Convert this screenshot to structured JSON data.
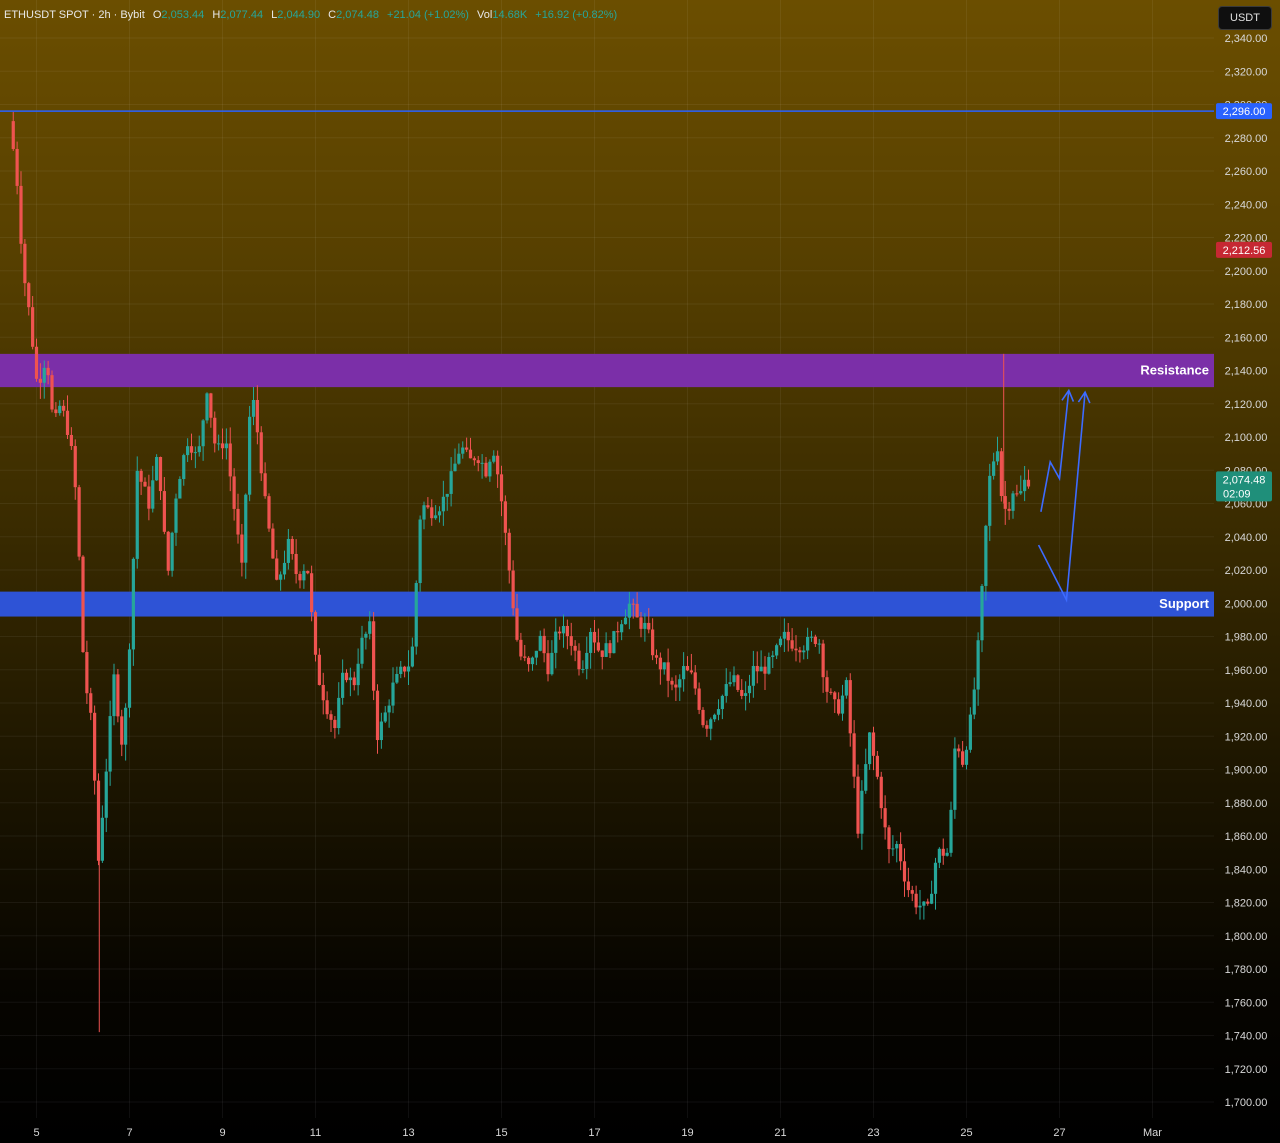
{
  "header": {
    "symbol": "ETHUSDT SPOT · 2h · Bybit",
    "open_label": "O",
    "open": "2,053.44",
    "high_label": "H",
    "high": "2,077.44",
    "low_label": "L",
    "low": "2,044.90",
    "close_label": "C",
    "close": "2,074.48",
    "change": "+21.04 (+1.02%)",
    "vol_label": "Vol",
    "vol": "14.68K",
    "vol_change": "+16.92 (+0.82%)"
  },
  "currency_button": "USDT",
  "chart_data": {
    "type": "candlestick",
    "price_axis": {
      "min": 1700,
      "max": 2340,
      "ticks": [
        "2,340.00",
        "2,320.00",
        "2,300.00",
        "2,280.00",
        "2,260.00",
        "2,240.00",
        "2,220.00",
        "2,200.00",
        "2,180.00",
        "2,160.00",
        "2,140.00",
        "2,120.00",
        "2,100.00",
        "2,080.00",
        "2,060.00",
        "2,040.00",
        "2,020.00",
        "2,000.00",
        "1,980.00",
        "1,960.00",
        "1,940.00",
        "1,920.00",
        "1,900.00",
        "1,880.00",
        "1,860.00",
        "1,840.00",
        "1,820.00",
        "1,800.00",
        "1,780.00",
        "1,760.00",
        "1,740.00",
        "1,720.00",
        "1,700.00"
      ]
    },
    "time_axis": {
      "labels": [
        {
          "text": "5",
          "day": 5
        },
        {
          "text": "7",
          "day": 7
        },
        {
          "text": "9",
          "day": 9
        },
        {
          "text": "11",
          "day": 11
        },
        {
          "text": "13",
          "day": 13
        },
        {
          "text": "15",
          "day": 15
        },
        {
          "text": "17",
          "day": 17
        },
        {
          "text": "19",
          "day": 19
        },
        {
          "text": "21",
          "day": 21
        },
        {
          "text": "23",
          "day": 23
        },
        {
          "text": "25",
          "day": 25
        },
        {
          "text": "27",
          "day": 27
        },
        {
          "text": "Mar",
          "day": 29
        }
      ]
    },
    "grid": true,
    "horizontal_line": {
      "price": 2296,
      "label": "2,296.00",
      "color": "#2962ff"
    },
    "price_labels": [
      {
        "price": 2212.56,
        "label": "2,212.56",
        "color": "#c62833"
      },
      {
        "price": 2074.48,
        "label": "2,074.48",
        "sublabel": "02:09",
        "color": "#1f8f7a"
      }
    ],
    "zones": [
      {
        "label": "Resistance",
        "low": 2130,
        "high": 2150,
        "color": "#7b2fa8"
      },
      {
        "label": "Support",
        "low": 1992,
        "high": 2007,
        "color": "#2e53d6"
      }
    ],
    "candle_colors": {
      "up": "#26a69a",
      "down": "#ef5350"
    },
    "anchors": [
      [
        4.5,
        2290
      ],
      [
        4.65,
        2260
      ],
      [
        4.8,
        2200
      ],
      [
        4.95,
        2170
      ],
      [
        5.1,
        2130
      ],
      [
        5.3,
        2150
      ],
      [
        5.45,
        2105
      ],
      [
        5.6,
        2120
      ],
      [
        5.8,
        2100
      ],
      [
        5.95,
        2060
      ],
      [
        6.1,
        1960
      ],
      [
        6.3,
        1920
      ],
      [
        6.4,
        1840
      ],
      [
        6.55,
        1890
      ],
      [
        6.75,
        1955
      ],
      [
        6.95,
        1910
      ],
      [
        7.1,
        1985
      ],
      [
        7.25,
        2080
      ],
      [
        7.5,
        2060
      ],
      [
        7.7,
        2090
      ],
      [
        7.9,
        2015
      ],
      [
        8.1,
        2070
      ],
      [
        8.35,
        2100
      ],
      [
        8.55,
        2085
      ],
      [
        8.75,
        2130
      ],
      [
        8.95,
        2090
      ],
      [
        9.15,
        2100
      ],
      [
        9.3,
        2065
      ],
      [
        9.5,
        2020
      ],
      [
        9.7,
        2130
      ],
      [
        9.85,
        2100
      ],
      [
        10.0,
        2060
      ],
      [
        10.25,
        2010
      ],
      [
        10.5,
        2035
      ],
      [
        10.7,
        2015
      ],
      [
        10.9,
        2025
      ],
      [
        11.1,
        1960
      ],
      [
        11.3,
        1940
      ],
      [
        11.5,
        1925
      ],
      [
        11.7,
        1960
      ],
      [
        11.9,
        1950
      ],
      [
        12.05,
        1975
      ],
      [
        12.25,
        1985
      ],
      [
        12.4,
        1920
      ],
      [
        12.55,
        1930
      ],
      [
        12.75,
        1950
      ],
      [
        12.95,
        1960
      ],
      [
        13.15,
        1965
      ],
      [
        13.35,
        2060
      ],
      [
        13.55,
        2055
      ],
      [
        13.8,
        2060
      ],
      [
        14.0,
        2075
      ],
      [
        14.2,
        2095
      ],
      [
        14.4,
        2085
      ],
      [
        14.55,
        2090
      ],
      [
        14.75,
        2080
      ],
      [
        14.9,
        2095
      ],
      [
        15.05,
        2070
      ],
      [
        15.25,
        2020
      ],
      [
        15.45,
        1970
      ],
      [
        15.7,
        1960
      ],
      [
        15.9,
        1980
      ],
      [
        16.1,
        1960
      ],
      [
        16.3,
        1985
      ],
      [
        16.55,
        1980
      ],
      [
        16.8,
        1960
      ],
      [
        17.0,
        1985
      ],
      [
        17.2,
        1970
      ],
      [
        17.45,
        1975
      ],
      [
        17.65,
        1990
      ],
      [
        17.85,
        2000
      ],
      [
        18.0,
        1990
      ],
      [
        18.2,
        1985
      ],
      [
        18.4,
        1965
      ],
      [
        18.6,
        1960
      ],
      [
        18.8,
        1945
      ],
      [
        19.0,
        1960
      ],
      [
        19.2,
        1955
      ],
      [
        19.45,
        1925
      ],
      [
        19.65,
        1935
      ],
      [
        19.85,
        1945
      ],
      [
        20.05,
        1955
      ],
      [
        20.3,
        1940
      ],
      [
        20.5,
        1960
      ],
      [
        20.7,
        1960
      ],
      [
        20.9,
        1965
      ],
      [
        21.15,
        1980
      ],
      [
        21.4,
        1975
      ],
      [
        21.6,
        1975
      ],
      [
        21.9,
        1980
      ],
      [
        22.05,
        1950
      ],
      [
        22.3,
        1935
      ],
      [
        22.5,
        1950
      ],
      [
        22.75,
        1865
      ],
      [
        23.0,
        1920
      ],
      [
        23.2,
        1890
      ],
      [
        23.4,
        1850
      ],
      [
        23.6,
        1855
      ],
      [
        23.8,
        1830
      ],
      [
        24.0,
        1820
      ],
      [
        24.25,
        1815
      ],
      [
        24.45,
        1850
      ],
      [
        24.7,
        1850
      ],
      [
        24.85,
        1920
      ],
      [
        25.0,
        1905
      ],
      [
        25.15,
        1925
      ],
      [
        25.3,
        1960
      ],
      [
        25.45,
        2020
      ],
      [
        25.55,
        2070
      ],
      [
        25.65,
        2085
      ],
      [
        25.75,
        2095
      ],
      [
        25.85,
        2060
      ],
      [
        25.95,
        2055
      ],
      [
        26.1,
        2070
      ],
      [
        26.2,
        2062
      ],
      [
        26.35,
        2074.48
      ]
    ],
    "special_wicks": [
      {
        "day": 6.35,
        "high": 1850,
        "low": 1742
      },
      {
        "day": 25.8,
        "high": 2150,
        "low": 2060
      }
    ],
    "projection_arrows": [
      {
        "points": [
          [
            26.6,
            2055
          ],
          [
            26.8,
            2085
          ],
          [
            27.0,
            2075
          ],
          [
            27.2,
            2128
          ]
        ]
      },
      {
        "points": [
          [
            26.55,
            2035
          ],
          [
            27.15,
            2002
          ],
          [
            27.55,
            2127
          ]
        ]
      }
    ]
  }
}
